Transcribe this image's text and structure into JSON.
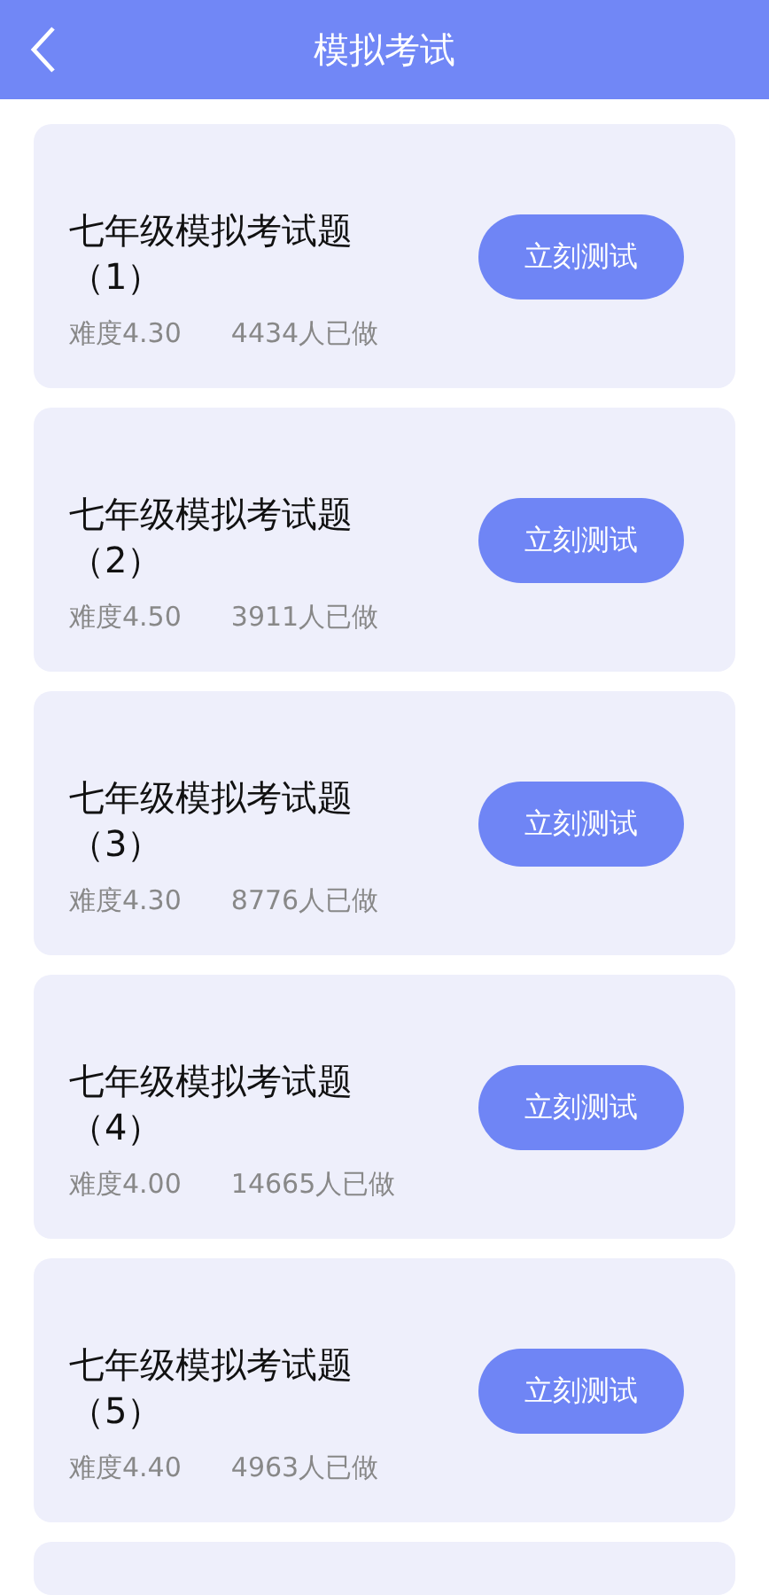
{
  "header": {
    "title": "模拟考试"
  },
  "exams": [
    {
      "title": "七年级模拟考试题（1）",
      "difficulty": "难度4.30",
      "count": "4434人已做",
      "button": "立刻测试"
    },
    {
      "title": "七年级模拟考试题（2）",
      "difficulty": "难度4.50",
      "count": "3911人已做",
      "button": "立刻测试"
    },
    {
      "title": "七年级模拟考试题（3）",
      "difficulty": "难度4.30",
      "count": "8776人已做",
      "button": "立刻测试"
    },
    {
      "title": "七年级模拟考试题（4）",
      "difficulty": "难度4.00",
      "count": "14665人已做",
      "button": "立刻测试"
    },
    {
      "title": "七年级模拟考试题（5）",
      "difficulty": "难度4.40",
      "count": "4963人已做",
      "button": "立刻测试"
    }
  ]
}
